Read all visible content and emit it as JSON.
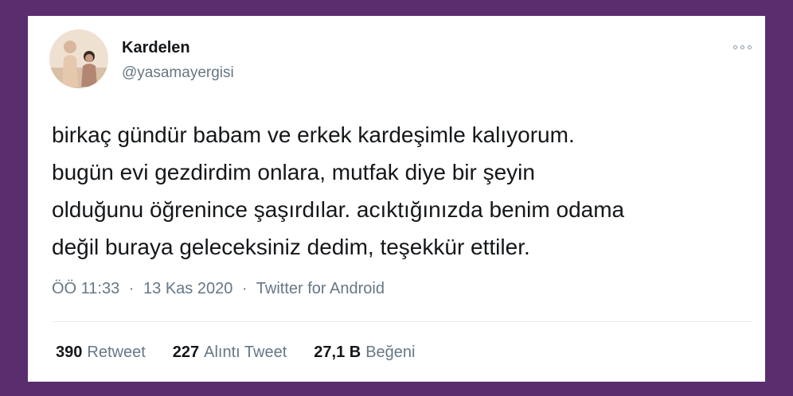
{
  "tweet": {
    "display_name": "Kardelen",
    "handle": "@yasamayergisi",
    "more_icon": "more-dots-icon",
    "text_lines": [
      "birkaç gündür babam ve erkek kardeşimle kalıyorum.",
      "bugün evi gezdirdim onlara, mutfak diye bir şeyin",
      "olduğunu öğrenince şaşırdılar. acıktığınızda benim odama",
      "değil buraya geleceksiniz dedim, teşekkür ettiler."
    ],
    "time": "ÖÖ 11:33",
    "separator": "·",
    "date": "13 Kas 2020",
    "source": "Twitter for Android",
    "stats": {
      "retweets_count": "390",
      "retweets_label": "Retweet",
      "quotes_count": "227",
      "quotes_label": "Alıntı Tweet",
      "likes_count": "27,1 B",
      "likes_label": "Beğeni"
    }
  },
  "colors": {
    "background": "#5a2d6f",
    "card": "#ffffff",
    "primary_text": "#14171a",
    "secondary_text": "#657786"
  }
}
